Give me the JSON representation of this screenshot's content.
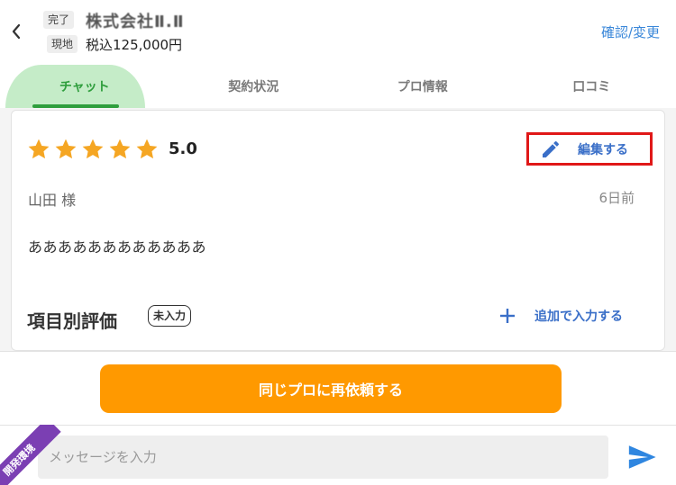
{
  "header": {
    "status_tag": "完了",
    "location_tag": "現地",
    "company_name": "株式会社Ⅱ.Ⅱ",
    "price": "税込125,000円",
    "confirm_link": "確認/変更"
  },
  "tabs": [
    {
      "label": "チャット",
      "active": true
    },
    {
      "label": "契約状況",
      "active": false
    },
    {
      "label": "プロ情報",
      "active": false
    },
    {
      "label": "口コミ",
      "active": false
    }
  ],
  "review": {
    "stars": 5,
    "rating": "5.0",
    "edit_label": "編集する",
    "reviewer": "山田 様",
    "date": "6日前",
    "text": "ああああああああああああ"
  },
  "item_rating": {
    "title": "項目別評価",
    "badge": "未入力",
    "add_label": "追加で入力する"
  },
  "request_button": "同じプロに再依頼する",
  "message": {
    "placeholder": "メッセージを入力"
  },
  "dev_ribbon": "開発環境",
  "colors": {
    "accent_green": "#2f9e3d",
    "tab_active_bg": "#c5ecc8",
    "link_blue": "#3a87d9",
    "star": "#f5a623",
    "request_orange": "#ff9900",
    "highlight_red": "#e01818",
    "send_blue": "#2f86e0"
  },
  "icons": {
    "back": "chevron-left-icon",
    "star": "star-icon",
    "edit": "pencil-icon",
    "add": "plus-icon",
    "send": "send-icon"
  }
}
